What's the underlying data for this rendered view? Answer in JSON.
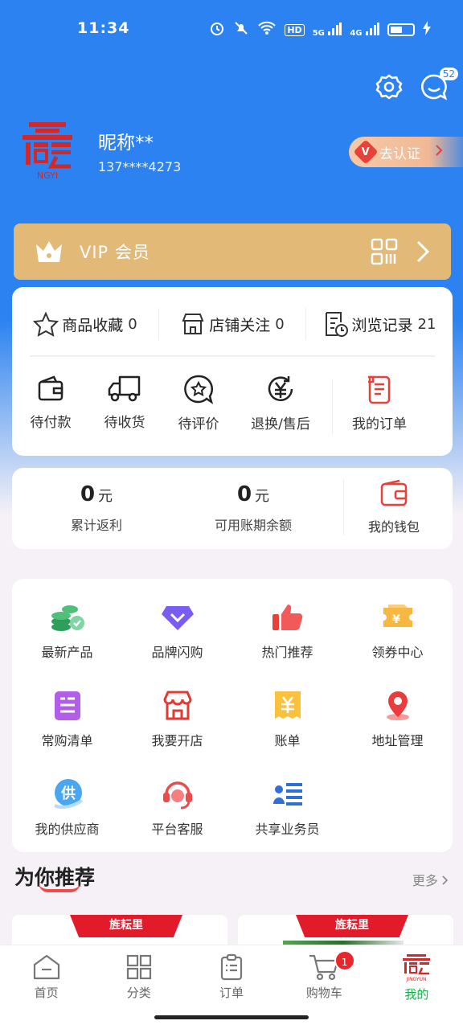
{
  "status_bar": {
    "time": "11:34",
    "icons": [
      "alarm-icon",
      "mute-icon",
      "wifi-icon",
      "hd-icon",
      "5g-signal-icon",
      "4g-signal-icon",
      "battery-icon"
    ],
    "hd": "HD",
    "net1": "5G",
    "net2": "4G"
  },
  "header": {
    "message_badge": "52"
  },
  "profile": {
    "nickname": "昵称**",
    "phone": "137****4273",
    "verify_label": "去认证",
    "verify_badge": "V",
    "logo_text": "NGYI"
  },
  "vip": {
    "label": "VIP 会员"
  },
  "favorites": [
    {
      "label": "商品收藏",
      "count": "0",
      "icon": "star-icon"
    },
    {
      "label": "店铺关注",
      "count": "0",
      "icon": "store-icon"
    },
    {
      "label": "浏览记录",
      "count": "21",
      "icon": "history-icon"
    }
  ],
  "orders": [
    {
      "label": "待付款",
      "icon": "wallet-icon"
    },
    {
      "label": "待收货",
      "icon": "truck-icon"
    },
    {
      "label": "待评价",
      "icon": "review-icon"
    },
    {
      "label": "退换/售后",
      "icon": "yuan-refund-icon"
    },
    {
      "label": "我的订单",
      "icon": "order-list-icon"
    }
  ],
  "finance": {
    "rebate_value": "0",
    "rebate_unit": "元",
    "rebate_label": "累计返利",
    "credit_value": "0",
    "credit_unit": "元",
    "credit_label": "可用账期余额",
    "wallet_label": "我的钱包"
  },
  "services": [
    {
      "label": "最新产品",
      "icon": "coins-icon"
    },
    {
      "label": "品牌闪购",
      "icon": "diamond-icon"
    },
    {
      "label": "热门推荐",
      "icon": "thumbs-up-icon"
    },
    {
      "label": "领券中心",
      "icon": "coupon-icon"
    },
    {
      "label": "常购清单",
      "icon": "list-icon"
    },
    {
      "label": "我要开店",
      "icon": "shop-icon"
    },
    {
      "label": "账单",
      "icon": "bill-icon"
    },
    {
      "label": "地址管理",
      "icon": "location-icon"
    },
    {
      "label": "我的供应商",
      "icon": "supplier-icon"
    },
    {
      "label": "平台客服",
      "icon": "headset-icon"
    },
    {
      "label": "共享业务员",
      "icon": "salesman-icon"
    }
  ],
  "recommend": {
    "title": "为你推荐",
    "more": "更多",
    "tag": "旌耘里"
  },
  "tabbar": [
    {
      "label": "首页",
      "icon": "home-icon"
    },
    {
      "label": "分类",
      "icon": "category-icon"
    },
    {
      "label": "订单",
      "icon": "order-icon"
    },
    {
      "label": "购物车",
      "icon": "cart-icon",
      "badge": "1"
    },
    {
      "label": "我的",
      "icon": "profile-logo-icon",
      "logo_text": "JINGYUN"
    }
  ],
  "colors": {
    "primary": "#2b82f0",
    "vip_gold": "#e3b977",
    "accent_red": "#e8262b",
    "active_green": "#19b04a"
  }
}
